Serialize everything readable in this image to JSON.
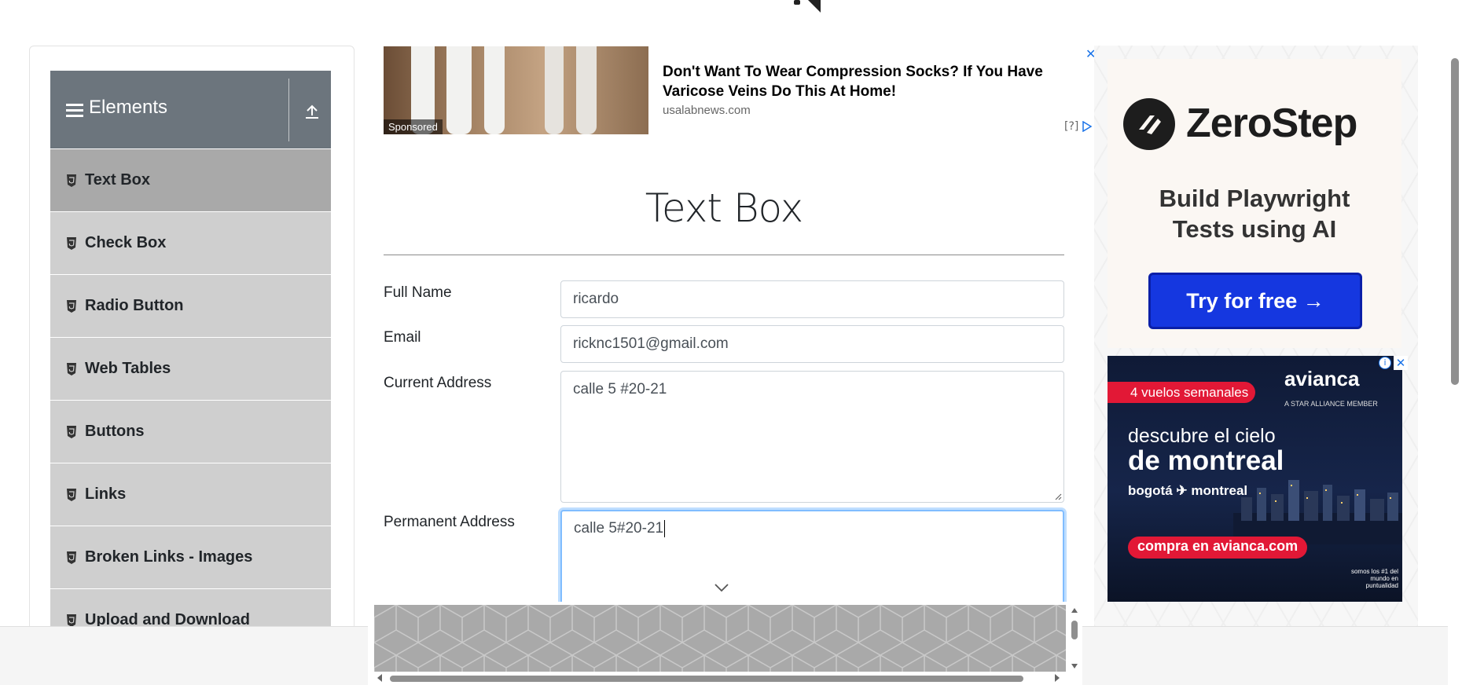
{
  "sidebar": {
    "group_title": "Elements",
    "items": [
      {
        "label": "Text Box",
        "active": true
      },
      {
        "label": "Check Box"
      },
      {
        "label": "Radio Button"
      },
      {
        "label": "Web Tables"
      },
      {
        "label": "Buttons"
      },
      {
        "label": "Links"
      },
      {
        "label": "Broken Links - Images"
      },
      {
        "label": "Upload and Download"
      }
    ]
  },
  "top_ad": {
    "sponsored_label": "Sponsored",
    "headline": "Don't Want To Wear Compression Socks? If You Have Varicose Veins Do This At Home!",
    "domain": "usalabnews.com",
    "info_label": "[?]"
  },
  "form": {
    "title": "Text Box",
    "full_name_label": "Full Name",
    "full_name_value": "ricardo",
    "email_label": "Email",
    "email_value": "ricknc1501@gmail.com",
    "current_address_label": "Current Address",
    "current_address_value": "calle 5 #20-21",
    "permanent_address_label": "Permanent Address",
    "permanent_address_value": "calle 5#20-21"
  },
  "zerostep_ad": {
    "brand": "ZeroStep",
    "tagline_line1": "Build Playwright",
    "tagline_line2": "Tests using AI",
    "cta": "Try for free →"
  },
  "avianca_ad": {
    "badge": "4 vuelos semanales",
    "logo": "avianca",
    "alliance": "A STAR ALLIANCE MEMBER",
    "line1": "descubre el cielo",
    "line2": "de montreal",
    "route": "bogotá ✈ montreal",
    "cta": "compra en avianca.com",
    "footer": "somos los #1 del mundo en puntualidad"
  },
  "colors": {
    "sidebar_header": "#6c757d",
    "menu_item": "#cfcfcf",
    "menu_item_active": "#a9a9a9",
    "focus_border": "#80bdff",
    "zerostep_button": "#1537e0",
    "avianca_red": "#e21836"
  }
}
